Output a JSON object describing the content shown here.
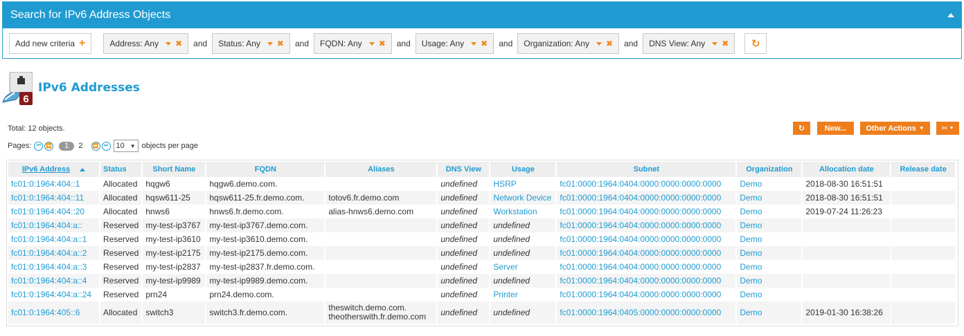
{
  "search": {
    "title": "Search for IPv6 Address Objects",
    "add_criteria_label": "Add new criteria",
    "criteria": [
      {
        "label": "Address: Any"
      },
      {
        "label": "Status: Any"
      },
      {
        "label": "FQDN: Any"
      },
      {
        "label": "Usage: Any"
      },
      {
        "label": "Organization: Any"
      },
      {
        "label": "DNS View: Any"
      }
    ],
    "joiner": "and"
  },
  "page": {
    "title": "IPv6 Addresses",
    "icon_badge": "6",
    "total": "Total: 12 objects.",
    "pages_label": "Pages:",
    "current_page": "1",
    "next_page": "2",
    "per_page_value": "10",
    "per_page_label": "objects per page"
  },
  "actions": {
    "new_label": "New...",
    "other_actions_label": "Other Actions"
  },
  "table": {
    "headers": [
      "IPv6 Address",
      "Status",
      "Short Name",
      "FQDN",
      "Aliases",
      "DNS View",
      "Usage",
      "Subnet",
      "Organization",
      "Allocation date",
      "Release date"
    ],
    "rows": [
      {
        "address": "fc01:0:1964:404::1",
        "status": "Allocated",
        "short": "hqgw6",
        "fqdn": "hqgw6.demo.com.",
        "aliases": "",
        "aliases2": "",
        "dns": "undefined",
        "usage": "HSRP",
        "subnet": "fc01:0000:1964:0404:0000:0000:0000:0000",
        "org": "Demo",
        "alloc": "2018-08-30 16:51:51",
        "release": ""
      },
      {
        "address": "fc01:0:1964:404::11",
        "status": "Allocated",
        "short": "hqsw611-25",
        "fqdn": "hqsw611-25.fr.demo.com.",
        "aliases": "totov6.fr.demo.com",
        "aliases2": "",
        "dns": "undefined",
        "usage": "Network Device",
        "subnet": "fc01:0000:1964:0404:0000:0000:0000:0000",
        "org": "Demo",
        "alloc": "2018-08-30 16:51:51",
        "release": ""
      },
      {
        "address": "fc01:0:1964:404::20",
        "status": "Allocated",
        "short": "hnws6",
        "fqdn": "hnws6.fr.demo.com.",
        "aliases": "alias-hnws6.demo.com",
        "aliases2": "",
        "dns": "undefined",
        "usage": "Workstation",
        "subnet": "fc01:0000:1964:0404:0000:0000:0000:0000",
        "org": "Demo",
        "alloc": "2019-07-24 11:26:23",
        "release": ""
      },
      {
        "address": "fc01:0:1964:404:a::",
        "status": "Reserved",
        "short": "my-test-ip3767",
        "fqdn": "my-test-ip3767.demo.com.",
        "aliases": "",
        "aliases2": "",
        "dns": "undefined",
        "usage": "undefined",
        "subnet": "fc01:0000:1964:0404:0000:0000:0000:0000",
        "org": "Demo",
        "alloc": "",
        "release": ""
      },
      {
        "address": "fc01:0:1964:404:a::1",
        "status": "Reserved",
        "short": "my-test-ip3610",
        "fqdn": "my-test-ip3610.demo.com.",
        "aliases": "",
        "aliases2": "",
        "dns": "undefined",
        "usage": "undefined",
        "subnet": "fc01:0000:1964:0404:0000:0000:0000:0000",
        "org": "Demo",
        "alloc": "",
        "release": ""
      },
      {
        "address": "fc01:0:1964:404:a::2",
        "status": "Reserved",
        "short": "my-test-ip2175",
        "fqdn": "my-test-ip2175.demo.com.",
        "aliases": "",
        "aliases2": "",
        "dns": "undefined",
        "usage": "undefined",
        "subnet": "fc01:0000:1964:0404:0000:0000:0000:0000",
        "org": "Demo",
        "alloc": "",
        "release": ""
      },
      {
        "address": "fc01:0:1964:404:a::3",
        "status": "Reserved",
        "short": "my-test-ip2837",
        "fqdn": "my-test-ip2837.fr.demo.com.",
        "aliases": "",
        "aliases2": "",
        "dns": "undefined",
        "usage": "Server",
        "subnet": "fc01:0000:1964:0404:0000:0000:0000:0000",
        "org": "Demo",
        "alloc": "",
        "release": ""
      },
      {
        "address": "fc01:0:1964:404:a::4",
        "status": "Reserved",
        "short": "my-test-ip9989",
        "fqdn": "my-test-ip9989.demo.com.",
        "aliases": "",
        "aliases2": "",
        "dns": "undefined",
        "usage": "undefined",
        "subnet": "fc01:0000:1964:0404:0000:0000:0000:0000",
        "org": "Demo",
        "alloc": "",
        "release": ""
      },
      {
        "address": "fc01:0:1964:404:a::24",
        "status": "Reserved",
        "short": "prn24",
        "fqdn": "prn24.demo.com.",
        "aliases": "",
        "aliases2": "",
        "dns": "undefined",
        "usage": "Printer",
        "subnet": "fc01:0000:1964:0404:0000:0000:0000:0000",
        "org": "Demo",
        "alloc": "",
        "release": ""
      },
      {
        "address": "fc01:0:1964:405::6",
        "status": "Allocated",
        "short": "switch3",
        "fqdn": "switch3.fr.demo.com.",
        "aliases": "theswitch.demo.com.",
        "aliases2": "theotherswith.fr.demo.com",
        "dns": "undefined",
        "usage": "undefined",
        "subnet": "fc01:0000:1964:0405:0000:0000:0000:0000",
        "org": "Demo",
        "alloc": "2019-01-30 16:38:26",
        "release": ""
      }
    ]
  }
}
